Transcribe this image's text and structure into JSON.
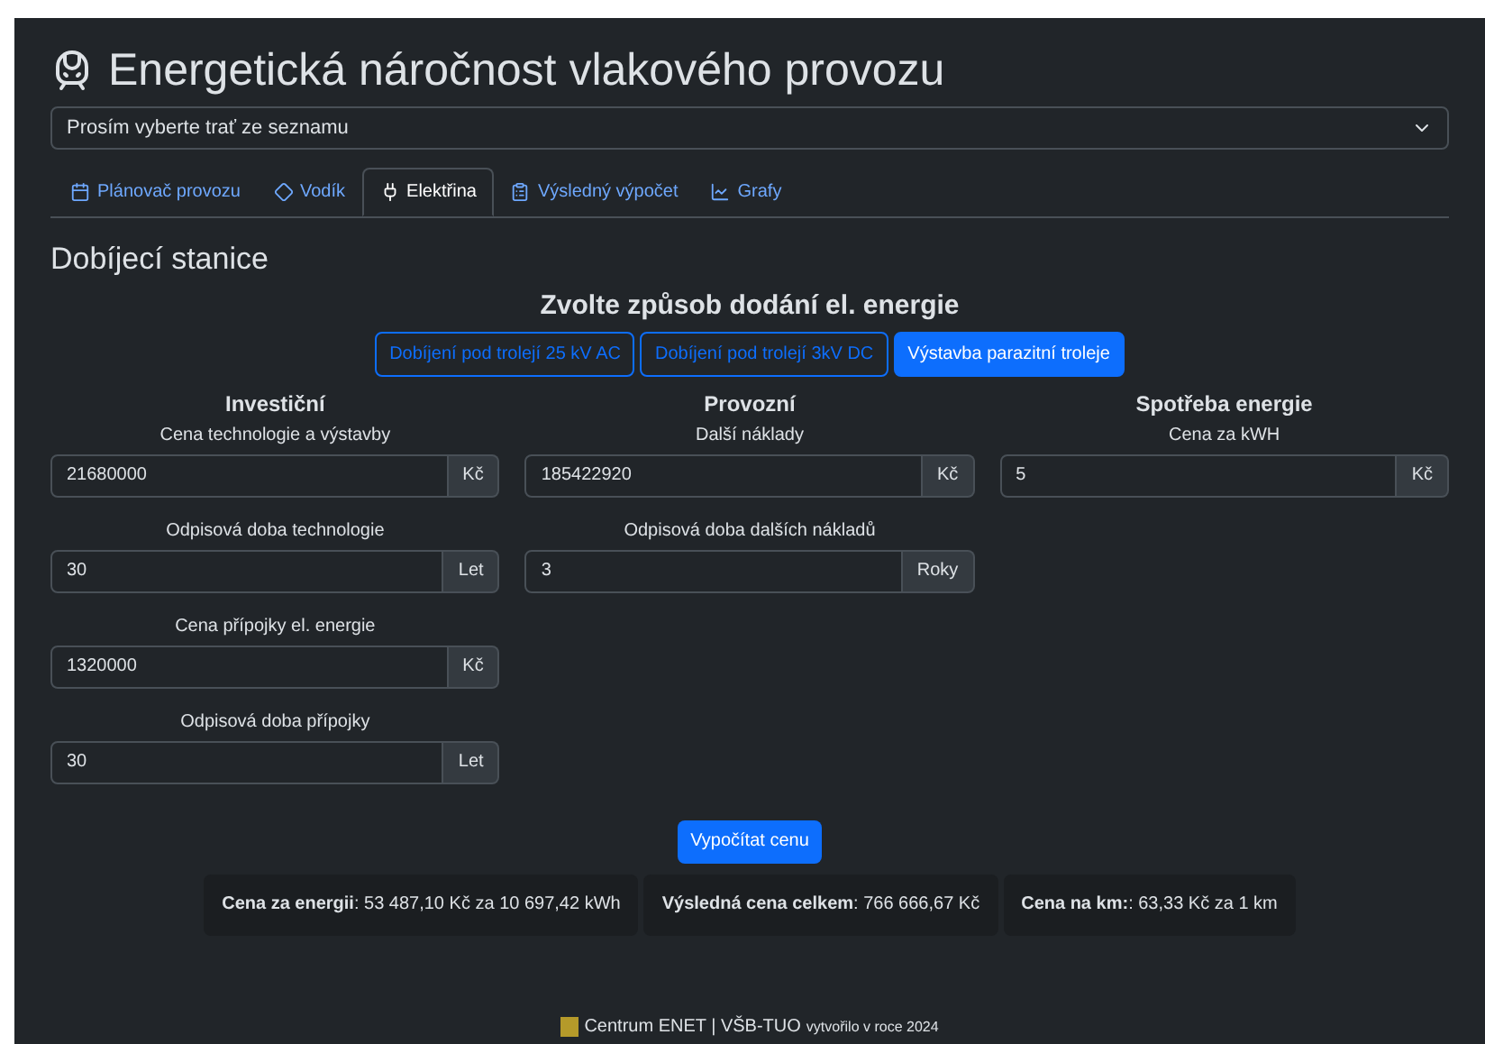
{
  "title": "Energetická náročnost vlakového provozu",
  "route_select": {
    "value": "Prosím vyberte trať ze seznamu"
  },
  "tabs": [
    {
      "label": "Plánovač provozu",
      "selected": false
    },
    {
      "label": "Vodík",
      "selected": false
    },
    {
      "label": "Elektřina",
      "selected": true
    },
    {
      "label": "Výsledný výpočet",
      "selected": false
    },
    {
      "label": "Grafy",
      "selected": false
    }
  ],
  "section_title": "Dobíjecí stanice",
  "delivery": {
    "title": "Zvolte způsob dodání el. energie",
    "options": [
      {
        "label": "Dobíjení pod trolejí 25 kV AC",
        "selected": false
      },
      {
        "label": "Dobíjení pod trolejí 3kV DC",
        "selected": false
      },
      {
        "label": "Výstavba parazitní troleje",
        "selected": true
      }
    ]
  },
  "columns": [
    {
      "title": "Investiční",
      "fields": [
        {
          "label": "Cena technologie a výstavby",
          "value": "21680000",
          "unit": "Kč"
        },
        {
          "label": "Odpisová doba technologie",
          "value": "30",
          "unit": "Let"
        },
        {
          "label": "Cena přípojky el. energie",
          "value": "1320000",
          "unit": "Kč"
        },
        {
          "label": "Odpisová doba přípojky",
          "value": "30",
          "unit": "Let"
        }
      ]
    },
    {
      "title": "Provozní",
      "fields": [
        {
          "label": "Další náklady",
          "value": "185422920",
          "unit": "Kč"
        },
        {
          "label": "Odpisová doba dalších nákladů",
          "value": "3",
          "unit": "Roky"
        }
      ]
    },
    {
      "title": "Spotřeba energie",
      "fields": [
        {
          "label": "Cena za kWH",
          "value": "5",
          "unit": "Kč"
        }
      ]
    }
  ],
  "calculate_button": "Vypočítat cenu",
  "results": [
    "**Cena za energii**: 53 487,10 Kč za 10 697,42 kWh",
    "**Výsledná cena celkem**: 766 666,67 Kč",
    "**Cena na km:**: 63,33 Kč za 1 km"
  ],
  "footer": {
    "name": "Centrum ENET | VŠB-TUO",
    "note": "vytvořilo v roce 2024"
  }
}
